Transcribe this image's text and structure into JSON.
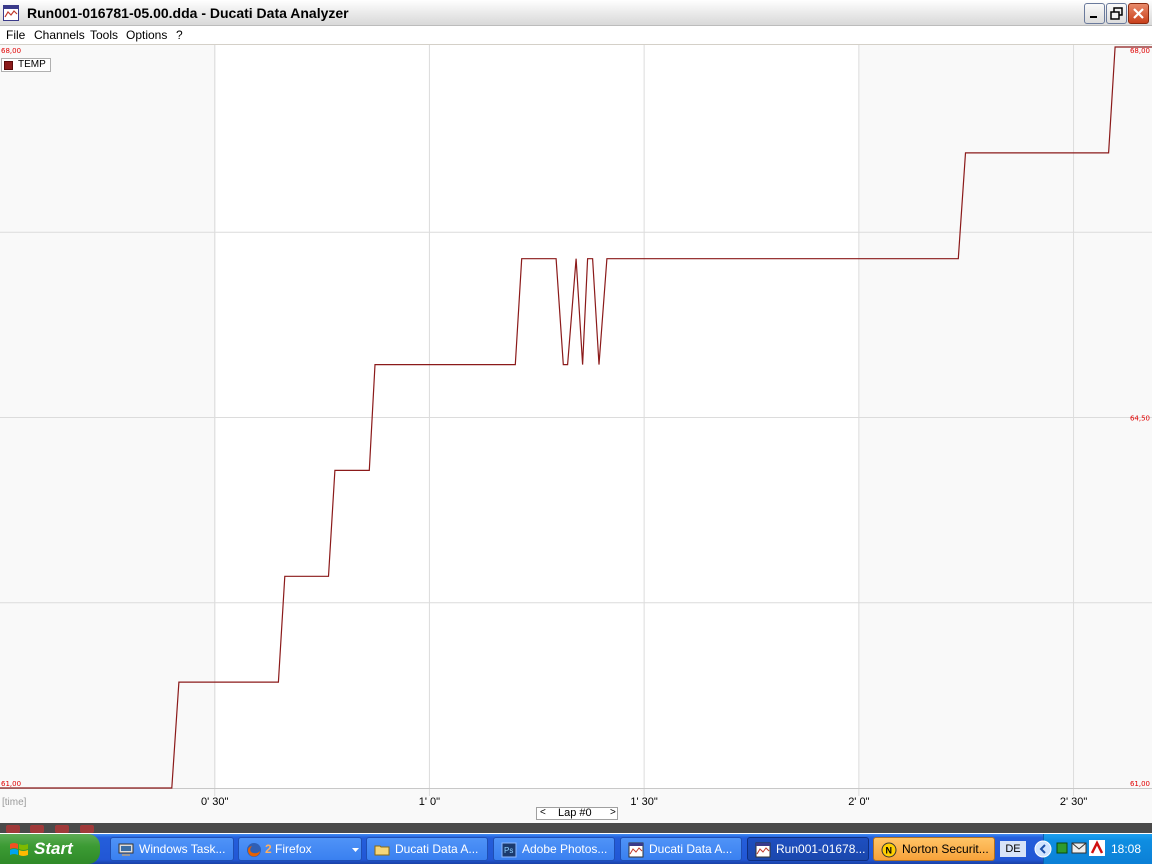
{
  "window": {
    "title": "Run001-016781-05.00.dda - Ducati Data Analyzer"
  },
  "menu": {
    "items": [
      "File",
      "Channels",
      "Tools",
      "Options",
      "?"
    ]
  },
  "chart_data": {
    "type": "line",
    "xlabel": "[time]",
    "x_unit": "seconds",
    "xlim": [
      0,
      175
    ],
    "ylim": [
      61.0,
      68.0
    ],
    "y_tick_labels": {
      "top_left": "68,00",
      "bottom_left": "61,00",
      "top_right": "68,00",
      "mid_right": "64,50",
      "bottom_right": "61,00"
    },
    "x_tick_labels": [
      "0' 30\"",
      "1' 0\"",
      "1' 30\"",
      "2' 0\"",
      "2' 30\""
    ],
    "x_tick_values": [
      30,
      60,
      90,
      120,
      150
    ],
    "grid": true,
    "legend_position": "top-left",
    "color": "#8b1a1a",
    "series": [
      {
        "name": "TEMP",
        "x": [
          0,
          24.0,
          25.0,
          38.9,
          39.8,
          45.9,
          46.8,
          51.6,
          52.4,
          72.0,
          72.9,
          77.7,
          78.7,
          79.3,
          80.5,
          81.4,
          82.1,
          82.8,
          83.7,
          84.8,
          85.7,
          133.9,
          134.9,
          154.9,
          155.8,
          175
        ],
        "y": [
          61.0,
          61.0,
          62.0,
          62.0,
          63.0,
          63.0,
          64.0,
          64.0,
          65.0,
          65.0,
          66.0,
          66.0,
          65.0,
          65.0,
          66.0,
          65.0,
          66.0,
          66.0,
          65.0,
          66.0,
          66.0,
          66.0,
          67.0,
          67.0,
          68.0,
          68.0
        ]
      }
    ]
  },
  "lap_nav": {
    "prev": "<",
    "label": "Lap #0",
    "next": ">"
  },
  "taskbar": {
    "start_label": "Start",
    "tasks": [
      {
        "label": "Windows Task...",
        "icon": "computer-icon"
      },
      {
        "label": "Firefox",
        "count": "2",
        "icon": "firefox-icon"
      },
      {
        "label": "Ducati Data A...",
        "icon": "folder-icon"
      },
      {
        "label": "Adobe Photos...",
        "icon": "photoshop-icon"
      },
      {
        "label": "Ducati Data A...",
        "icon": "dda-icon"
      },
      {
        "label": "Run001-01678...",
        "icon": "dda-icon"
      },
      {
        "label": "Norton Securit...",
        "icon": "norton-icon"
      }
    ],
    "language": "DE",
    "clock": "18:08"
  }
}
